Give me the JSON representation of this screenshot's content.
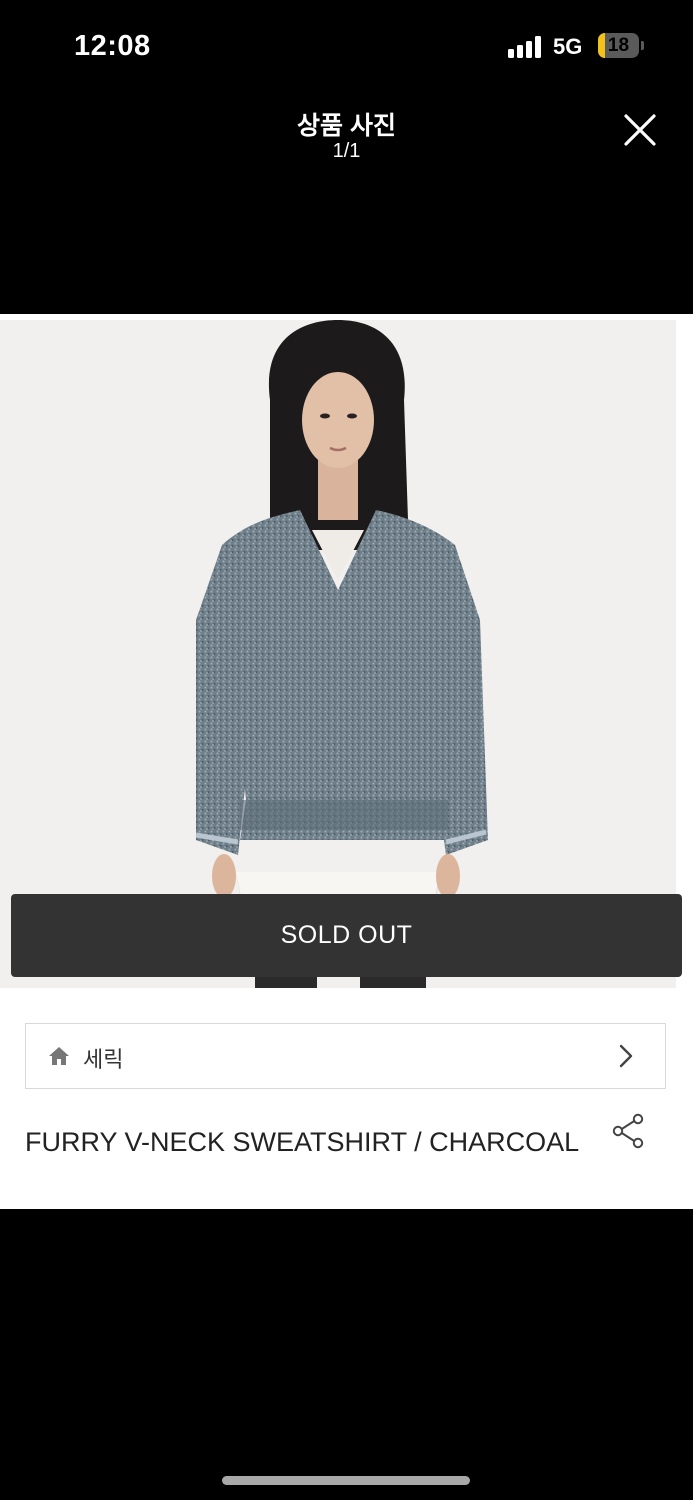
{
  "status_bar": {
    "time": "12:08",
    "network": "5G",
    "battery": "18",
    "battery_level": 0.18
  },
  "viewer": {
    "title": "상품 사진",
    "counter": "1/1",
    "close_icon": "close-icon"
  },
  "product": {
    "photo_icon": "product-photo",
    "sold_out_label": "SOLD OUT",
    "brand": {
      "icon": "home-icon",
      "name": "세릭",
      "chevron": "chevron-right-icon"
    },
    "name": "FURRY V-NECK SWEATSHIRT / CHARCOAL",
    "share_icon": "share-icon"
  },
  "colors": {
    "background": "#000000",
    "card": "#ffffff",
    "sold_out_bg": "#333333",
    "battery": "#f2c21a"
  }
}
